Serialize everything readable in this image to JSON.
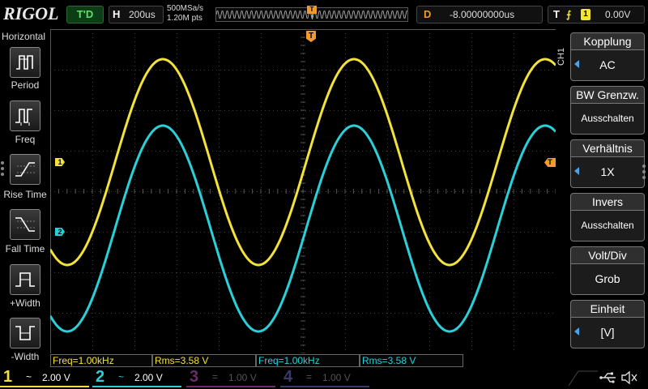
{
  "brand": "RIGOL",
  "trigger_status": "T'D",
  "horizontal": {
    "label": "H",
    "timebase": "200us"
  },
  "sample": {
    "rate": "500MSa/s",
    "points": "1.20M pts"
  },
  "delay": {
    "label": "D",
    "value": "-8.00000000us"
  },
  "trigger": {
    "label": "T",
    "edge_symbol": "⨍",
    "source": "1",
    "level": "0.00V"
  },
  "markers": {
    "trigger_top": "T",
    "ch1": "1",
    "ch2": "2",
    "trigger_level": "T"
  },
  "left_menu": {
    "title": "Horizontal",
    "items": [
      {
        "label": "Period",
        "icon": "period-icon"
      },
      {
        "label": "Freq",
        "icon": "freq-icon"
      },
      {
        "label": "Rise Time",
        "icon": "rise-time-icon"
      },
      {
        "label": "Fall Time",
        "icon": "fall-time-icon"
      },
      {
        "label": "+Width",
        "icon": "positive-width-icon"
      },
      {
        "label": "-Width",
        "icon": "negative-width-icon"
      }
    ]
  },
  "right_menu": {
    "channel_tab": "CH1",
    "items": [
      {
        "title": "Kopplung",
        "value": "AC",
        "arrow": true
      },
      {
        "title": "BW Grenzw.",
        "value": "Ausschalten",
        "arrow": false
      },
      {
        "title": "Verhältnis",
        "value": "1X",
        "arrow": true
      },
      {
        "title": "Invers",
        "value": "Ausschalten",
        "arrow": false
      },
      {
        "title": "Volt/Div",
        "value": "Grob",
        "arrow": false
      },
      {
        "title": "Einheit",
        "value": "[V]",
        "arrow": true
      }
    ]
  },
  "measurements": [
    {
      "text": "Freq=1.00kHz",
      "channel": 1
    },
    {
      "text": "Rms=3.58 V",
      "channel": 1
    },
    {
      "text": "Freq=1.00kHz",
      "channel": 2
    },
    {
      "text": "Rms=3.58 V",
      "channel": 2
    }
  ],
  "channels": [
    {
      "num": "1",
      "coupling": "~",
      "scale": "2.00 V",
      "color": "#f2e23a",
      "active": true
    },
    {
      "num": "2",
      "coupling": "~",
      "scale": "2.00 V",
      "color": "#2ad0d8",
      "active": true
    },
    {
      "num": "3",
      "coupling": "=",
      "scale": "1.00 V",
      "color": "#8a3a8a",
      "active": false
    },
    {
      "num": "4",
      "coupling": "=",
      "scale": "1.00 V",
      "color": "#4a4a9a",
      "active": false
    }
  ],
  "waveforms": {
    "ch1": {
      "color": "#f2e23a",
      "frequency_khz": 1.0
    },
    "ch2": {
      "color": "#2ad0d8",
      "frequency_khz": 1.0
    }
  },
  "colors": {
    "accent": "#f29a2a",
    "menu_arrow": "#4aa3e6"
  }
}
